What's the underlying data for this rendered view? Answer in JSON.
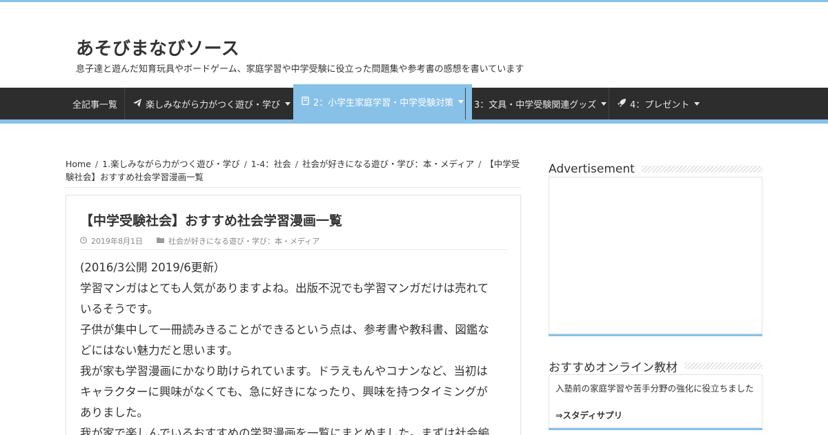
{
  "site": {
    "title": "あそびまなびソース",
    "description": "息子達と遊んだ知育玩具やボードゲーム、家庭学習や中学受験に役立った問題集や参考書の感想を書いています"
  },
  "nav": {
    "items": [
      {
        "label": "全記事一覧",
        "icon": "",
        "has_dropdown": false
      },
      {
        "label": "楽しみながら力がつく遊び・学び",
        "icon": "paper-plane-icon",
        "has_dropdown": true
      },
      {
        "label": "2：小学生家庭学習・中学受験対策",
        "icon": "book-icon",
        "has_dropdown": true,
        "active": true
      },
      {
        "label": "3：文具・中学受験関連グッズ",
        "icon": "",
        "has_dropdown": true
      },
      {
        "label": "4：プレゼント",
        "icon": "rocket-icon",
        "has_dropdown": true
      }
    ]
  },
  "breadcrumb": {
    "items": [
      "Home",
      "1.楽しみながら力がつく遊び・学び",
      "1-4：社会",
      "社会が好きになる遊び・学び：本・メディア",
      "【中学受験社会】おすすめ社会学習漫画一覧"
    ]
  },
  "article": {
    "title": "【中学受験社会】おすすめ社会学習漫画一覧",
    "date": "2019年8月1日",
    "category": "社会が好きになる遊び・学び：本・メディア",
    "lines": [
      "(2016/3公開 2019/6更新）",
      "学習マンガはとても人気がありますよね。出版不況でも学習マンガだけは売れて",
      "いるそうです。",
      "子供が集中して一冊読みきることができるという点は、参考書や教科書、図鑑な",
      "どにはない魅力だと思います。",
      "我が家も学習漫画にかなり助けられています。ドラえもんやコナンなど、当初は",
      "キャラクターに興味がなくても、急に好きになったり、興味を持つタイミングが",
      "ありました。",
      "我が家で楽しんでいるおすすめの学習漫画を一覧にまとめました。まずは社会編"
    ]
  },
  "sidebar": {
    "ad_title": "Advertisement",
    "rec_title": "おすすめオンライン教材",
    "rec_text": "入塾前の家庭学習や苦手分野の強化に役立ちました",
    "rec_link": "⇒スタディサプリ"
  },
  "colors": {
    "accent": "#88c1e8",
    "nav_bg": "#2d2d2d"
  }
}
